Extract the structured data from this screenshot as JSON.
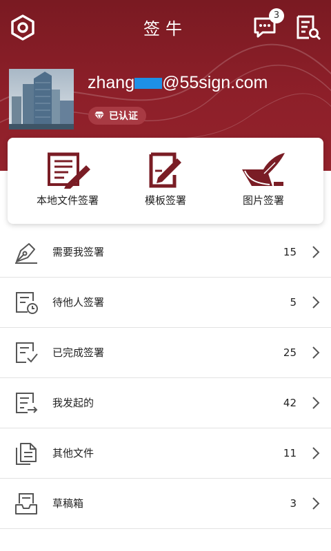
{
  "header": {
    "title": "签牛",
    "message_badge_count": "3",
    "icons": [
      "hexagon-settings-icon",
      "message-icon",
      "document-search-icon"
    ]
  },
  "profile": {
    "email_prefix": "zhang",
    "email_suffix": "@55sign.com",
    "verified_label": "已认证"
  },
  "quick_actions": [
    {
      "label": "本地文件签署",
      "icon": "local-file-sign-icon"
    },
    {
      "label": "模板签署",
      "icon": "template-sign-icon"
    },
    {
      "label": "图片签署",
      "icon": "image-sign-icon"
    }
  ],
  "menu": [
    {
      "label": "需要我签署",
      "count": "15",
      "icon": "pen-nib-icon"
    },
    {
      "label": "待他人签署",
      "count": "5",
      "icon": "document-clock-icon"
    },
    {
      "label": "已完成签署",
      "count": "25",
      "icon": "document-check-icon"
    },
    {
      "label": "我发起的",
      "count": "42",
      "icon": "document-send-icon"
    },
    {
      "label": "其他文件",
      "count": "11",
      "icon": "files-icon"
    },
    {
      "label": "草稿箱",
      "count": "3",
      "icon": "inbox-tray-icon"
    }
  ],
  "colors": {
    "brand": "#8d1f29",
    "icon_gray": "#555555"
  }
}
